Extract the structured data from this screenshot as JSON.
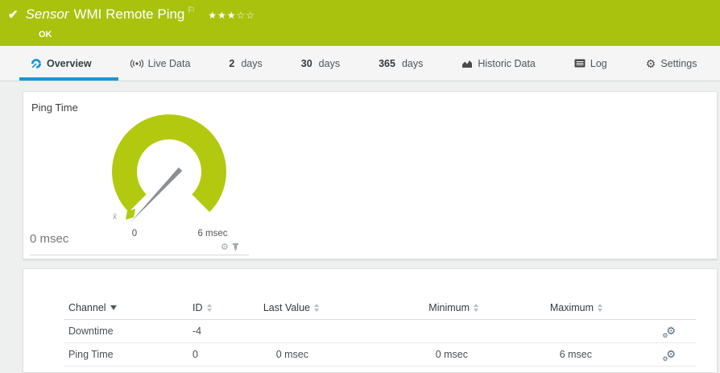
{
  "colors": {
    "brand_green": "#a8c20e",
    "gauge_green": "#b2c90f",
    "accent_blue": "#1b96d2"
  },
  "header": {
    "kind_label": "Sensor",
    "title": "WMI Remote Ping",
    "status": "OK",
    "rating_stars": "★★★☆☆",
    "flag_icon": "⚐",
    "check_icon": "✔"
  },
  "tabs": [
    {
      "label": "Overview",
      "icon": "gauge-icon",
      "active": true
    },
    {
      "label": "Live Data",
      "icon": "broadcast-icon"
    },
    {
      "num": "2",
      "label": "days"
    },
    {
      "num": "30",
      "label": "days"
    },
    {
      "num": "365",
      "label": "days"
    },
    {
      "label": "Historic Data",
      "icon": "area-chart-icon"
    },
    {
      "label": "Log",
      "icon": "log-icon"
    },
    {
      "label": "Settings",
      "icon": "gear-icon"
    }
  ],
  "gauge": {
    "title": "Ping Time",
    "min_label": "0",
    "max_label": "6 msec",
    "current_label": "0 msec",
    "avg_marker": "x̄",
    "value_msec": 0,
    "scale_min_msec": 0,
    "scale_max_msec": 6
  },
  "table": {
    "columns": [
      {
        "label": "Channel",
        "sort": "desc"
      },
      {
        "label": "ID",
        "sort": "none"
      },
      {
        "label": "Last Value",
        "sort": "none"
      },
      {
        "label": "Minimum",
        "sort": "none"
      },
      {
        "label": "Maximum",
        "sort": "none"
      }
    ],
    "rows": [
      {
        "channel": "Downtime",
        "id": "-4",
        "last_value": "",
        "minimum": "",
        "maximum": ""
      },
      {
        "channel": "Ping Time",
        "id": "0",
        "last_value": "0 msec",
        "minimum": "0 msec",
        "maximum": "6 msec"
      }
    ]
  }
}
